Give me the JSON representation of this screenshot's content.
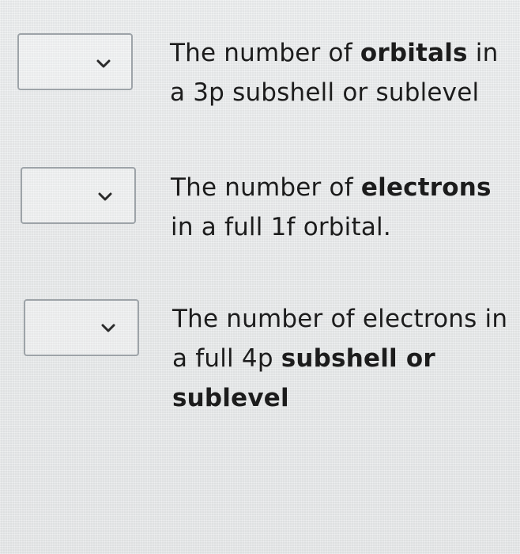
{
  "questions": [
    {
      "select": {
        "selected": "",
        "icon": "chevron-down-icon"
      },
      "lines": [
        [
          {
            "t": "The number of ",
            "b": false
          },
          {
            "t": "orbitals",
            "b": true
          },
          {
            "t": " in",
            "b": false
          }
        ],
        [
          {
            "t": "a 3p subshell or sublevel",
            "b": false
          }
        ]
      ]
    },
    {
      "select": {
        "selected": "",
        "icon": "chevron-down-icon"
      },
      "lines": [
        [
          {
            "t": "The number of ",
            "b": false
          },
          {
            "t": "electrons",
            "b": true
          }
        ],
        [
          {
            "t": "in a full 1f orbital.",
            "b": false
          }
        ]
      ]
    },
    {
      "select": {
        "selected": "",
        "icon": "chevron-down-icon"
      },
      "lines": [
        [
          {
            "t": "The number of electrons in",
            "b": false
          }
        ],
        [
          {
            "t": "a full 4p ",
            "b": false
          },
          {
            "t": "subshell or",
            "b": true
          }
        ],
        [
          {
            "t": "sublevel",
            "b": true
          }
        ]
      ]
    }
  ]
}
